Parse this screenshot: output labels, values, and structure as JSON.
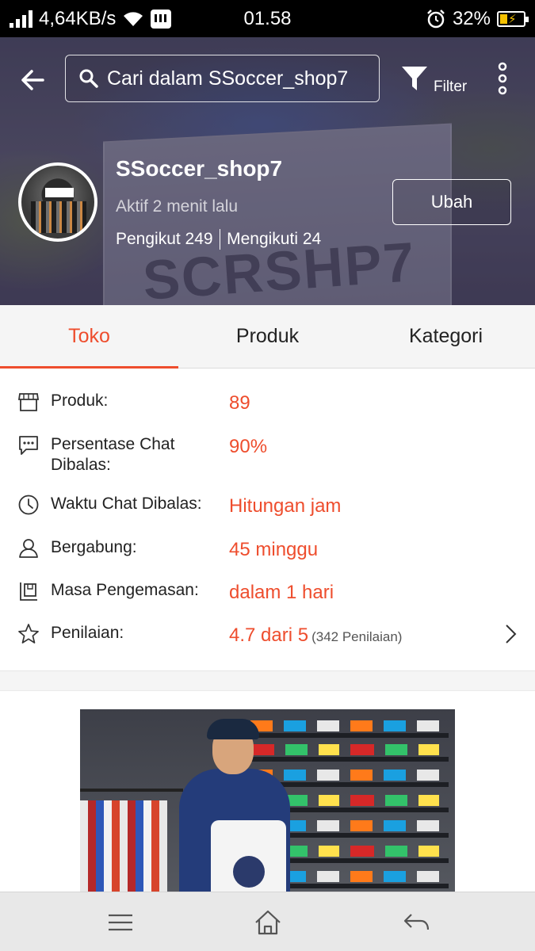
{
  "status_bar": {
    "network_speed": "4,64KB/s",
    "time": "01.58",
    "battery": "32%",
    "icons": [
      "signal-icon",
      "wifi-icon",
      "bbm-icon",
      "alarm-icon",
      "battery-charging-icon"
    ]
  },
  "header": {
    "search_placeholder": "Cari dalam SSoccer_shop7",
    "filter_label": "Filter",
    "watermark": "SCRSHP7",
    "shop_name": "SSoccer_shop7",
    "active_status": "Aktif 2 menit lalu",
    "followers": "Pengikut 249",
    "following": "Mengikuti 24",
    "edit_label": "Ubah"
  },
  "tabs": [
    {
      "label": "Toko",
      "active": true
    },
    {
      "label": "Produk",
      "active": false
    },
    {
      "label": "Kategori",
      "active": false
    }
  ],
  "info": {
    "rows": [
      {
        "icon": "store-icon",
        "label": "Produk:",
        "value": "89",
        "extra": ""
      },
      {
        "icon": "chat-icon",
        "label": "Persentase Chat Dibalas:",
        "value": "90%",
        "extra": ""
      },
      {
        "icon": "clock-icon",
        "label": "Waktu Chat Dibalas:",
        "value": "Hitungan jam",
        "extra": ""
      },
      {
        "icon": "user-icon",
        "label": "Bergabung:",
        "value": "45 minggu",
        "extra": ""
      },
      {
        "icon": "package-icon",
        "label": "Masa Pengemasan:",
        "value": "dalam 1 hari",
        "extra": ""
      },
      {
        "icon": "star-icon",
        "label": "Penilaian:",
        "value": "4.7 dari 5",
        "extra": "(342 Penilaian)"
      }
    ]
  },
  "colors": {
    "accent": "#ee4d2d",
    "tab_bg": "#f5f5f5",
    "nav_bg": "#e8e8e8"
  }
}
